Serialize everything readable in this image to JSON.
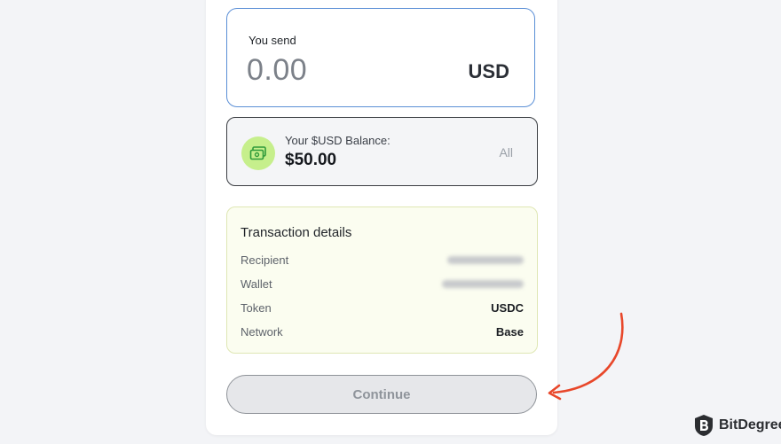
{
  "send": {
    "label": "You send",
    "amount": "0.00",
    "currency": "USD"
  },
  "balance": {
    "label": "Your $USD Balance:",
    "value": "$50.00",
    "all_label": "All",
    "icon": "wallet-cash-icon"
  },
  "transaction": {
    "title": "Transaction details",
    "rows": [
      {
        "label": "Recipient",
        "value": ""
      },
      {
        "label": "Wallet",
        "value": ""
      },
      {
        "label": "Token",
        "value": "USDC"
      },
      {
        "label": "Network",
        "value": "Base"
      }
    ]
  },
  "continue_label": "Continue",
  "watermark": {
    "text": "BitDegree"
  },
  "colors": {
    "accent_border": "#5b8fd6",
    "icon_bg": "#c6ef8c",
    "arrow": "#e8472a"
  }
}
